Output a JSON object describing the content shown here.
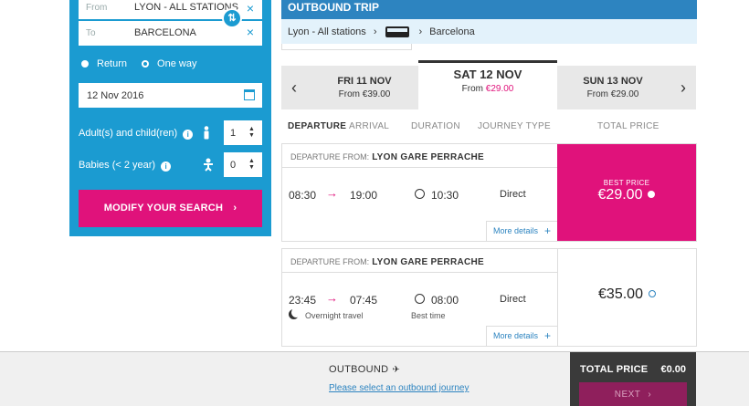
{
  "search": {
    "from_label": "From",
    "from_value": "LYON - ALL STATIONS",
    "to_label": "To",
    "to_value": "BARCELONA",
    "trip_types": [
      "Return",
      "One way"
    ],
    "selected_trip_type": "One way",
    "date": "12 Nov 2016",
    "adults_label": "Adult(s) and child(ren)",
    "adults_value": "1",
    "babies_label": "Babies (< 2 year)",
    "babies_value": "0",
    "modify_label": "MODIFY YOUR SEARCH",
    "clear_icon": "×",
    "swap_icon": "⇅",
    "info_icon": "i",
    "chevron": "›",
    "stepper_arrows": "▲▼"
  },
  "outbound": {
    "title": "OUTBOUND TRIP",
    "route_from": "Lyon - All stations",
    "route_to": "Barcelona",
    "route_sep": "›"
  },
  "dates": {
    "prev": {
      "day": "FRI 11 NOV",
      "from": "From",
      "price": "€39.00"
    },
    "current": {
      "day": "SAT 12 NOV",
      "from": "From",
      "price": "€29.00"
    },
    "next": {
      "day": "SUN 13 NOV",
      "from": "From",
      "price": "€29.00"
    },
    "prev_arrow": "‹",
    "next_arrow": "›"
  },
  "columns": {
    "departure": "DEPARTURE",
    "arrival": "ARRIVAL",
    "duration": "DURATION",
    "journey_type": "JOURNEY TYPE",
    "total_price": "TOTAL PRICE"
  },
  "journeys": [
    {
      "dep_from_label": "DEPARTURE FROM:",
      "station": "LYON GARE PERRACHE",
      "depart": "08:30",
      "arrive": "19:00",
      "duration": "10:30",
      "type": "Direct",
      "more": "More details",
      "best_label": "BEST PRICE",
      "price": "€29.00"
    },
    {
      "dep_from_label": "DEPARTURE FROM:",
      "station": "LYON GARE PERRACHE",
      "depart": "23:45",
      "arrive": "07:45",
      "duration": "08:00",
      "type": "Direct",
      "overnight": "Overnight travel",
      "best_time": "Best time",
      "more": "More details",
      "price": "€35.00"
    }
  ],
  "footer": {
    "outbound_label": "OUTBOUND",
    "select_prompt": "Please select an outbound journey",
    "total_label": "TOTAL PRICE",
    "total_value": "€0.00",
    "next_label": "NEXT",
    "arrow": "→",
    "plus": "+",
    "plane": "✈"
  },
  "colors": {
    "panel_blue": "#1b9bd1",
    "header_blue": "#2d84c0",
    "accent_pink": "#e0127b"
  }
}
